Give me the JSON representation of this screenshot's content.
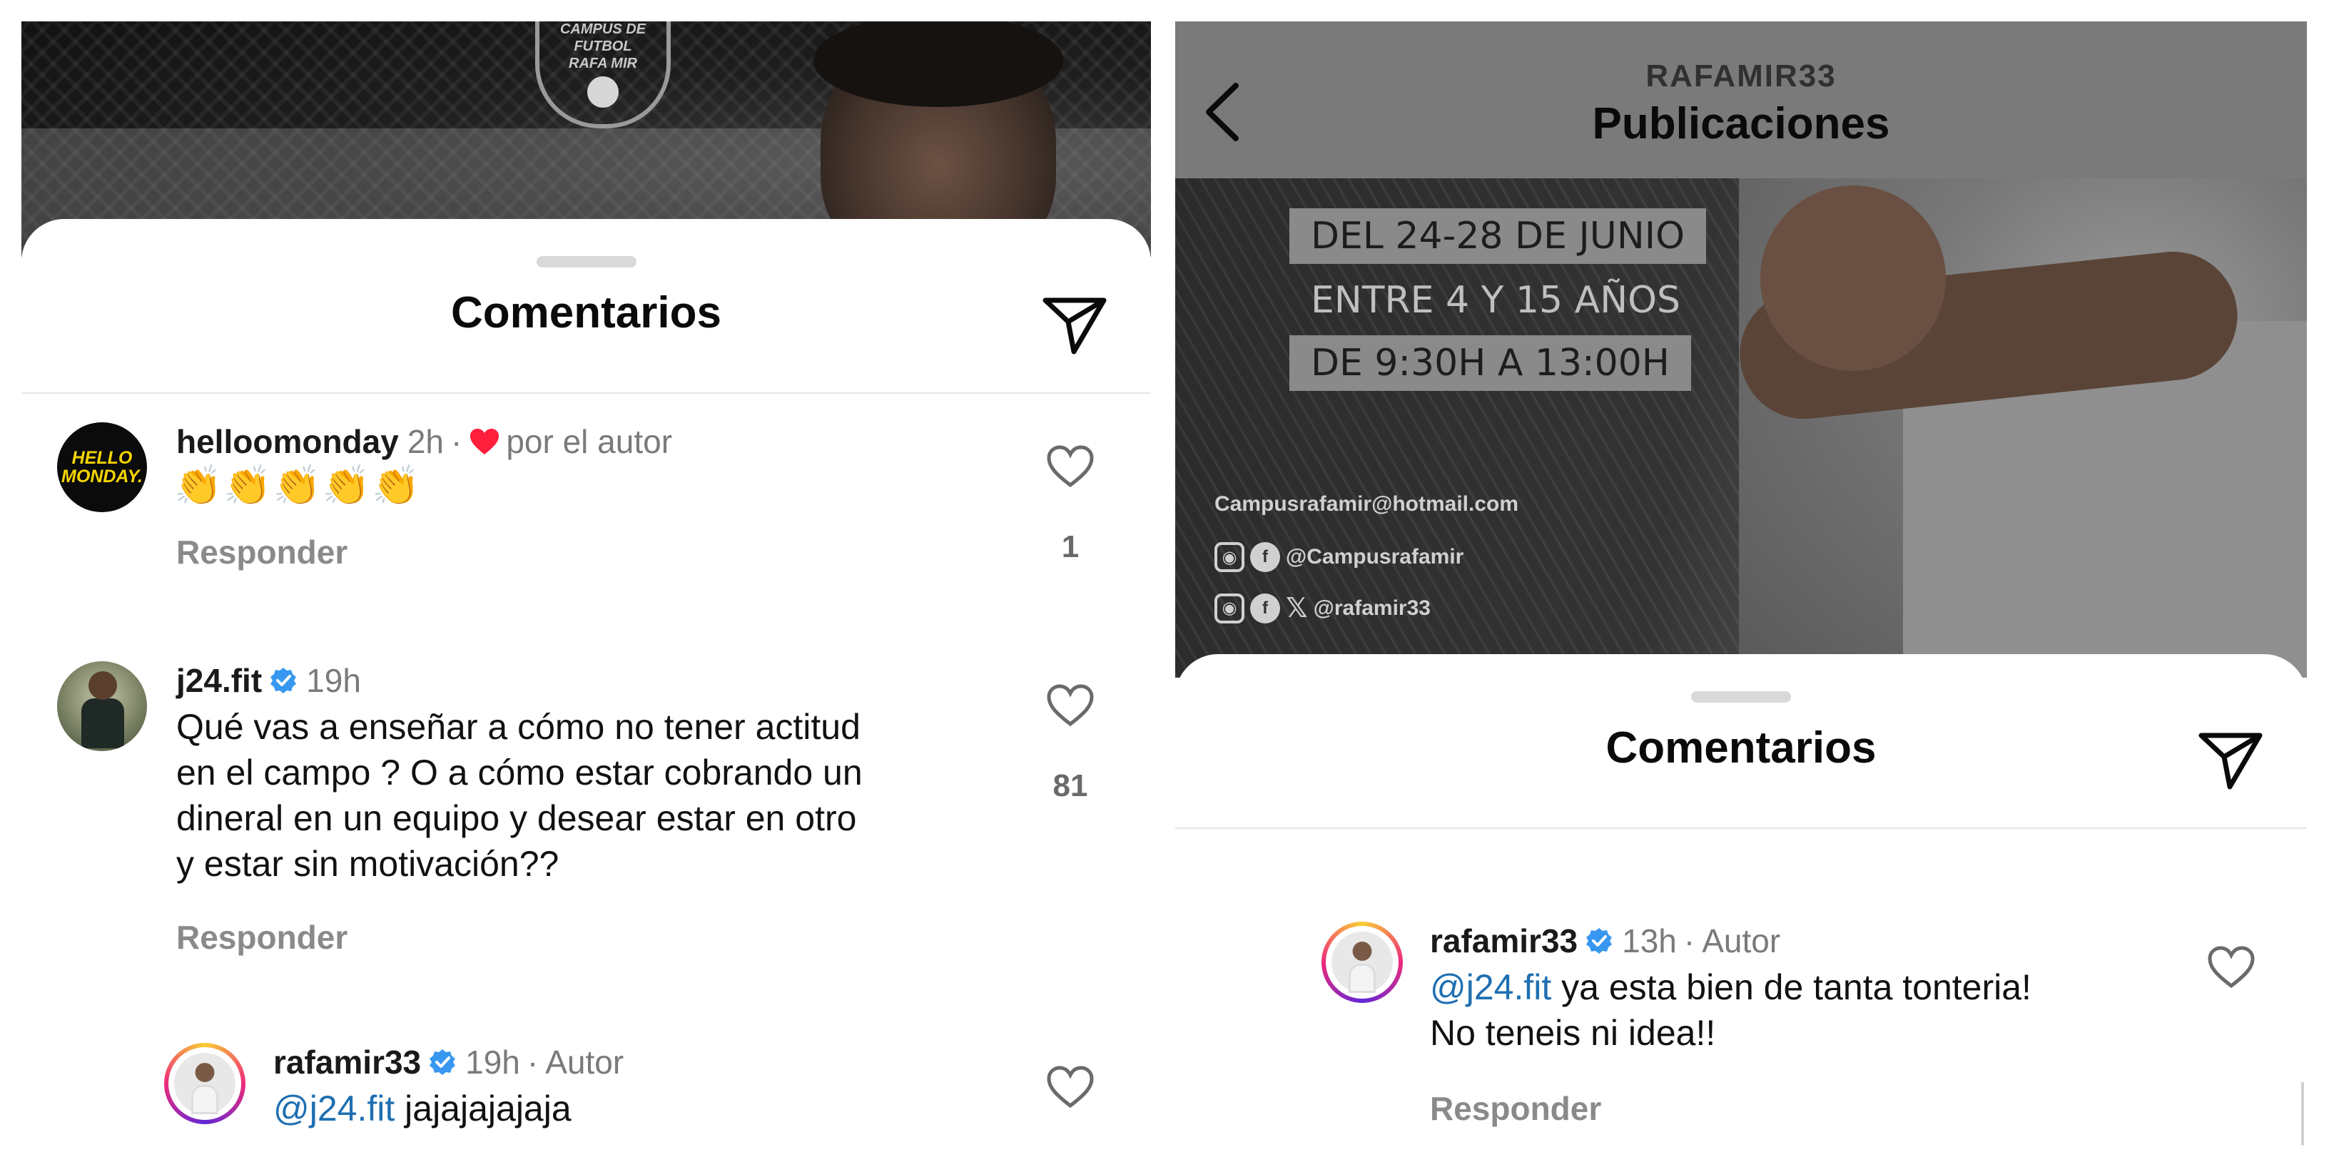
{
  "left": {
    "background": {
      "crest_lines": [
        "CAMPUS DE FUTBOL",
        "RAFA MIR"
      ]
    },
    "sheet": {
      "title": "Comentarios",
      "comments": [
        {
          "username": "helloomonday",
          "avatar_text": "HELLO MONDAY.",
          "time": "2h",
          "separator": "·",
          "liked_by_author": "por el autor",
          "text": "👏👏👏👏👏",
          "reply_label": "Responder",
          "like_count": "1"
        },
        {
          "username": "j24.fit",
          "verified": true,
          "time": "19h",
          "text_lines": [
            "Qué vas a enseñar a cómo no tener actitud",
            "en el campo ? O a cómo estar cobrando un",
            "dineral en un equipo y desear estar en otro",
            "y estar sin motivación??"
          ],
          "reply_label": "Responder",
          "like_count": "81"
        },
        {
          "username": "rafamir33",
          "verified": true,
          "time": "19h",
          "separator": "·",
          "author_tag": "Autor",
          "mention": "@j24.fit",
          "text": " jajajajajaja"
        }
      ]
    }
  },
  "right": {
    "header": {
      "username": "RAFAMIR33",
      "title": "Publicaciones"
    },
    "background": {
      "promo_lines": [
        "DEL 24-28 DE JUNIO",
        "ENTRE 4 Y 15 AÑOS",
        "DE 9:30H A 13:00H"
      ],
      "email": "Campusrafamir@hotmail.com",
      "handle1": "@Campusrafamir",
      "handle2": "@rafamir33"
    },
    "sheet": {
      "title": "Comentarios",
      "comment": {
        "username": "rafamir33",
        "verified": true,
        "time": "13h",
        "separator": "·",
        "author_tag": "Autor",
        "mention": "@j24.fit",
        "text_line1": " ya esta bien de tanta tonteria!",
        "text_line2": "No teneis ni idea!!",
        "reply_label": "Responder"
      }
    }
  },
  "colors": {
    "mention": "#1f6fb2",
    "verified": "#3897f0",
    "heart": "#ff1e3c",
    "story_ring": [
      "#f9ce34",
      "#ee2a7b",
      "#6228d7"
    ]
  },
  "icons": [
    "back-chevron-icon",
    "send-icon",
    "heart-icon",
    "verified-badge-icon",
    "heart-filled-icon",
    "instagram-icon",
    "facebook-icon",
    "x-icon"
  ]
}
